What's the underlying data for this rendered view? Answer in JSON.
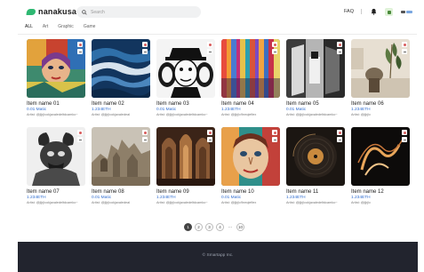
{
  "brand": {
    "name": "nanakusa",
    "accent": "#2eb872"
  },
  "search": {
    "placeholder": "Search",
    "icon": "search-icon"
  },
  "header": {
    "faq_label": "FAQ",
    "bell_icon": "bell-icon",
    "wallet_icon": "wallet-icon",
    "toggle_icon": "language-toggle-icon"
  },
  "tabs": [
    {
      "label": "ALL",
      "active": true
    },
    {
      "label": "Art",
      "active": false
    },
    {
      "label": "Graphic",
      "active": false
    },
    {
      "label": "Game",
      "active": false
    }
  ],
  "items": [
    {
      "name": "Item name 01",
      "price": "0.01 Matic",
      "artist": "Artist: @jljrjlcokjaxaledeltdcamko~"
    },
    {
      "name": "Item name 02",
      "price": "1.234ETH",
      "artist": "Artist: @jljrjlcokjaxaledeal"
    },
    {
      "name": "Item name 03",
      "price": "0.01 Matic",
      "artist": "Artist: @jljrjlcokjaxaledeltdcamko~"
    },
    {
      "name": "Item name 04",
      "price": "1.234ETH",
      "artist": "Artist: @jljrjlc9neqiefiex"
    },
    {
      "name": "Item name 05",
      "price": "0.01 Matic",
      "artist": "Artist: @jljrjlcokjaxaledeltdcamko~"
    },
    {
      "name": "Item name 06",
      "price": "1.234ETH",
      "artist": "Artist: @jljrjlc"
    },
    {
      "name": "Item name 07",
      "price": "1.234ETH",
      "artist": "Artist: @jljrjlcokjaxaledeltdcamko~"
    },
    {
      "name": "Item name 08",
      "price": "0.01 Matic",
      "artist": "Artist: @jljrjlcokjaxaledeal"
    },
    {
      "name": "Item name 09",
      "price": "1.234ETH",
      "artist": "Artist: @jljrjlcokjaxaledeltdcamko~"
    },
    {
      "name": "Item name 10",
      "price": "0.01 Matic",
      "artist": "Artist: @jljrjlc9neqiefiex"
    },
    {
      "name": "Item name 11",
      "price": "1.234ETH",
      "artist": "Artist: @jljrjlcokjaxaledeltdcamko~"
    },
    {
      "name": "Item name 12",
      "price": "1.234ETH",
      "artist": "Artist: @jljrjlc"
    }
  ],
  "pagination": {
    "pages": [
      "1",
      "2",
      "3",
      "4"
    ],
    "ellipsis": "···",
    "last": "10",
    "current": "1"
  },
  "footer": {
    "copyright": "© Smartapp Inc."
  }
}
